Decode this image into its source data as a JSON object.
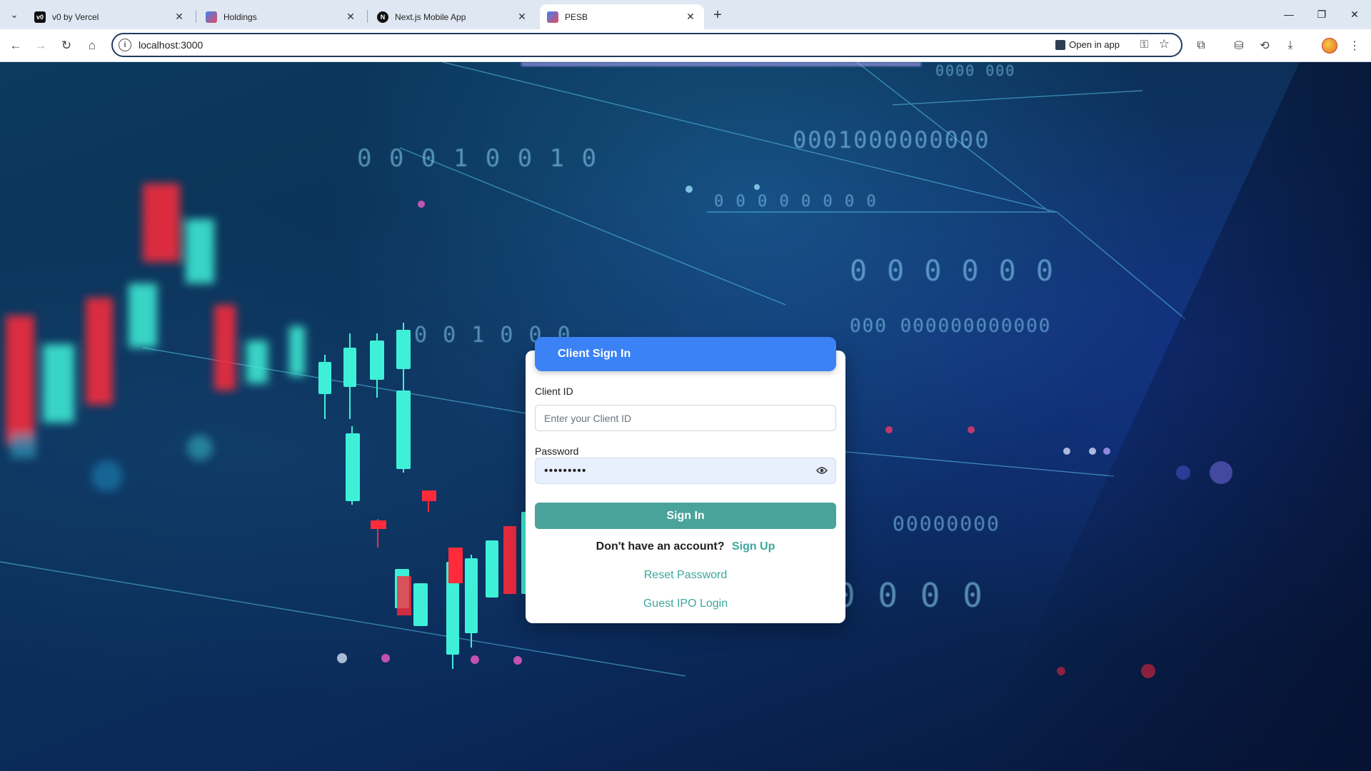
{
  "browser": {
    "tabs": [
      {
        "title": "v0 by Vercel",
        "favicon": "v0-logo-icon",
        "favicon_color": "#111111",
        "active": false
      },
      {
        "title": "Holdings",
        "favicon": "app-icon",
        "favicon_color": "#3b82f6",
        "active": false
      },
      {
        "title": "Next.js Mobile App",
        "favicon": "nextjs-icon",
        "favicon_color": "#111111",
        "active": false
      },
      {
        "title": "PESB",
        "favicon": "app-icon",
        "favicon_color": "#3b82f6",
        "active": true
      }
    ],
    "url": "localhost:3000",
    "open_in_app_label": "Open in app"
  },
  "login": {
    "header": "Client Sign In",
    "client_id_label": "Client ID",
    "client_id_placeholder": "Enter your Client ID",
    "password_label": "Password",
    "password_value": "•••••••••",
    "sign_in_label": "Sign In",
    "no_account_text": "Don't have an account?",
    "sign_up_label": "Sign Up",
    "reset_password_label": "Reset Password",
    "guest_ipo_label": "Guest IPO Login"
  },
  "colors": {
    "header_blue": "#3b82f6",
    "button_teal": "#4aa39a",
    "link_teal": "#3aa89e",
    "candle_green": "#3ff0d8",
    "candle_red": "#ff2a3a"
  }
}
